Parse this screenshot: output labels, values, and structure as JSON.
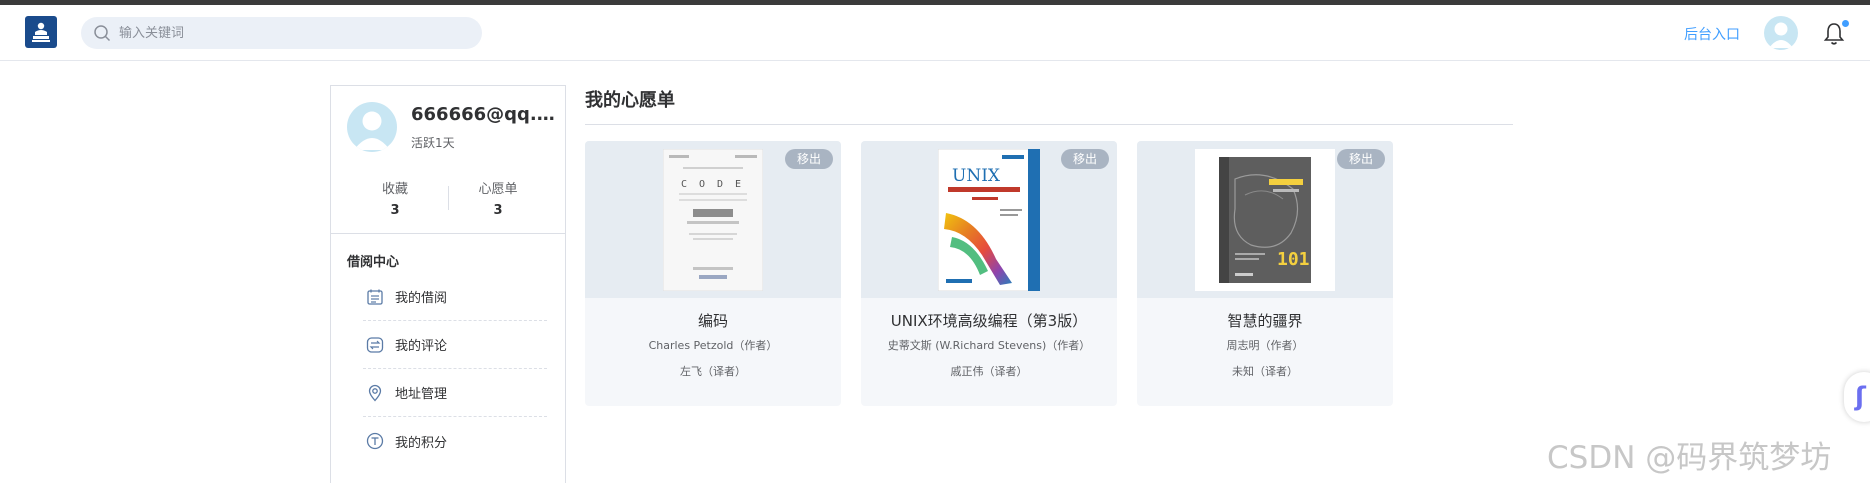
{
  "header": {
    "search_placeholder": "输入关键词",
    "admin_link": "后台入口",
    "notification_dot_color": "#409eff"
  },
  "profile": {
    "username": "666666@qq.c...",
    "active": "活跃1天",
    "stats": [
      {
        "label": "收藏",
        "count": "3"
      },
      {
        "label": "心愿单",
        "count": "3"
      }
    ]
  },
  "sidebar": {
    "section_title": "借阅中心",
    "items": [
      {
        "label": "我的借阅",
        "icon": "list-icon"
      },
      {
        "label": "我的评论",
        "icon": "comment-icon"
      },
      {
        "label": "地址管理",
        "icon": "location-icon"
      },
      {
        "label": "我的积分",
        "icon": "points-icon"
      }
    ]
  },
  "main": {
    "title": "我的心愿单",
    "remove_label": "移出",
    "books": [
      {
        "title": "编码",
        "author": "Charles Petzold（作者）",
        "translator": "左飞（译者）"
      },
      {
        "title": "UNIX环境高级编程（第3版）",
        "author": "史蒂文斯 (W.Richard Stevens)（作者）",
        "translator": "戚正伟（译者）"
      },
      {
        "title": "智慧的疆界",
        "author": "周志明（作者）",
        "translator": "未知（译者）"
      }
    ]
  },
  "watermark": "CSDN @码界筑梦坊"
}
